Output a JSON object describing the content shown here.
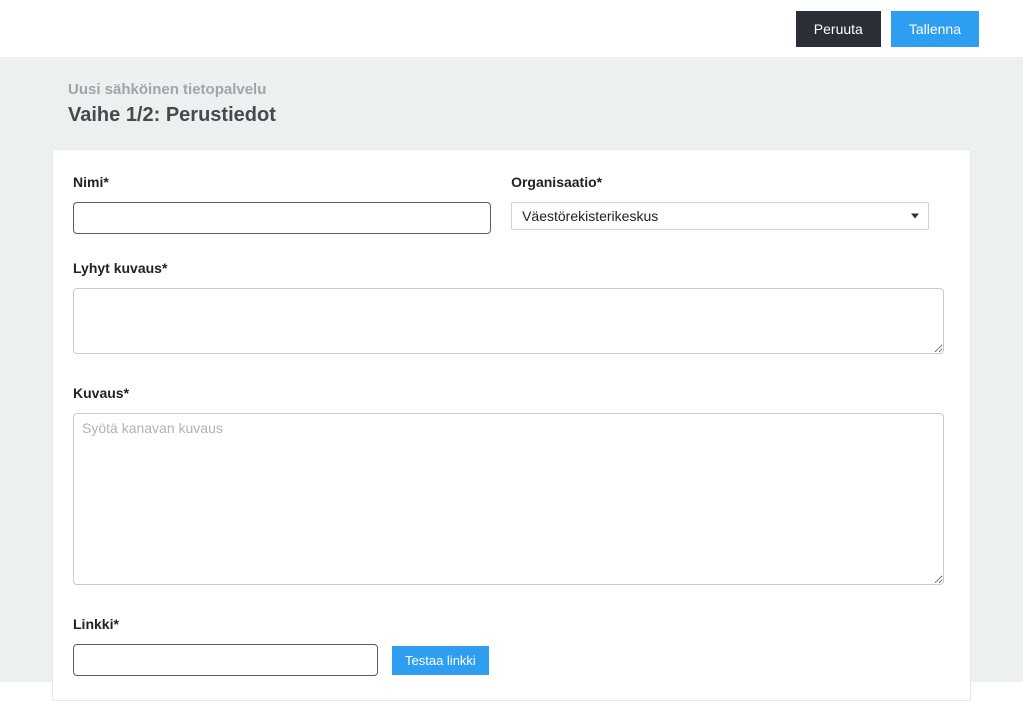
{
  "topbar": {
    "cancel_label": "Peruuta",
    "save_label": "Tallenna"
  },
  "page": {
    "subtitle": "Uusi sähköinen tietopalvelu",
    "title": "Vaihe 1/2: Perustiedot"
  },
  "form": {
    "name": {
      "label": "Nimi*",
      "value": ""
    },
    "organization": {
      "label": "Organisaatio*",
      "selected": "Väestörekisterikeskus"
    },
    "short_description": {
      "label": "Lyhyt kuvaus*",
      "value": ""
    },
    "description": {
      "label": "Kuvaus*",
      "placeholder": "Syötä kanavan kuvaus",
      "value": ""
    },
    "link": {
      "label": "Linkki*",
      "value": "",
      "test_label": "Testaa linkki"
    }
  }
}
